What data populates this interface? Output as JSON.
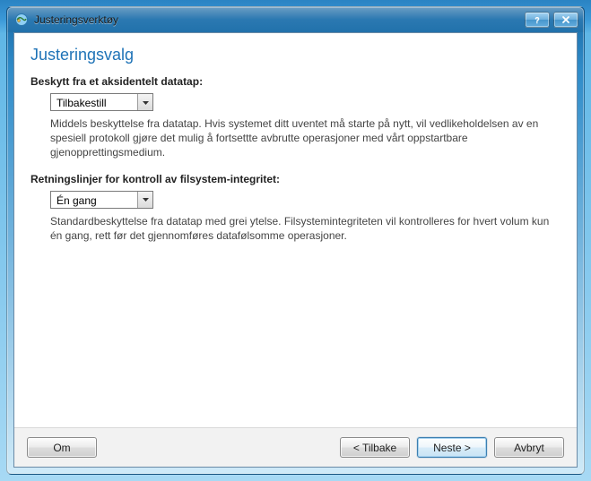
{
  "window": {
    "title": "Justeringsverktøy"
  },
  "page": {
    "heading": "Justeringsvalg"
  },
  "sections": {
    "dataloss": {
      "label": "Beskytt fra et aksidentelt datatap:",
      "selected": "Tilbakestill",
      "desc": "Middels beskyttelse fra datatap. Hvis systemet ditt uventet må starte på nytt, vil vedlikeholdelsen av en spesiell protokoll gjøre det mulig å fortsettte avbrutte operasjoner med vårt oppstartbare gjenopprettingsmedium."
    },
    "integrity": {
      "label": "Retningslinjer for kontroll av filsystem-integritet:",
      "selected": "Én gang",
      "desc": "Standardbeskyttelse fra datatap med grei ytelse. Filsystemintegriteten vil kontrolleres for hvert volum kun én gang, rett før det gjennomføres datafølsomme operasjoner."
    }
  },
  "buttons": {
    "about": "Om",
    "back": "< Tilbake",
    "next": "Neste >",
    "cancel": "Avbryt"
  }
}
